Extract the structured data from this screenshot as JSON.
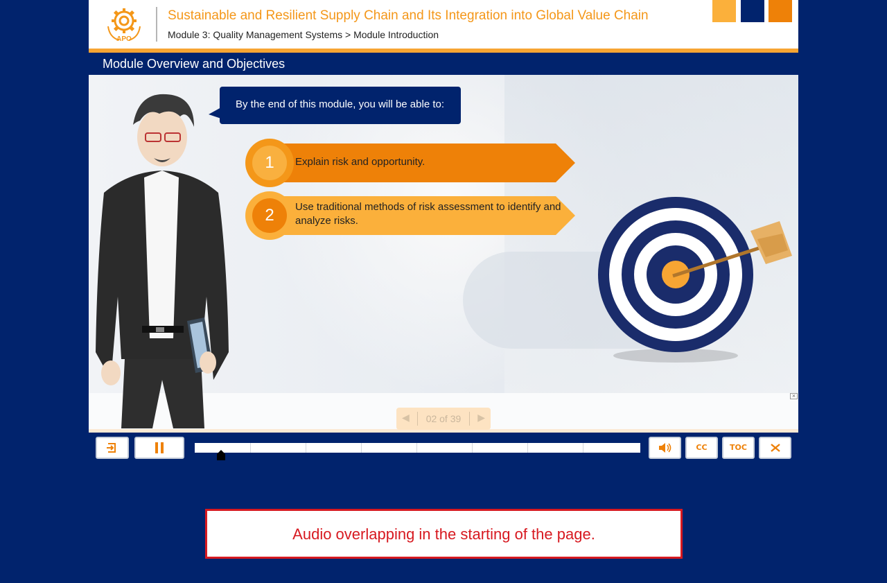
{
  "course": {
    "title": "Sustainable and Resilient Supply Chain and Its Integration into Global Value Chain",
    "breadcrumb": "Module 3: Quality Management Systems > Module Introduction",
    "logo_text": "APO"
  },
  "section": {
    "title": "Module Overview and Objectives"
  },
  "slide": {
    "intro": "By the end of this module, you will be able to:",
    "objectives": [
      {
        "number": "1",
        "text": "Explain risk and opportunity."
      },
      {
        "number": "2",
        "text": "Use traditional methods of risk assessment to identify and analyze risks."
      }
    ]
  },
  "pager": {
    "text": "02 of 39",
    "current": 2,
    "total": 39
  },
  "controls": {
    "exit_icon": "exit-icon",
    "pause_icon": "pause-icon",
    "audio_icon": "speaker-icon",
    "cc_label": "CC",
    "toc_label": "TOC",
    "fullscreen_icon": "fullscreen-icon",
    "progress_fraction": 0.05
  },
  "note": {
    "text": "Audio overlapping in the starting of the page."
  },
  "colors": {
    "navy": "#01236d",
    "orange": "#ee8108",
    "light_orange": "#fbb03b",
    "title_orange": "#f49719",
    "note_red": "#d71920"
  }
}
